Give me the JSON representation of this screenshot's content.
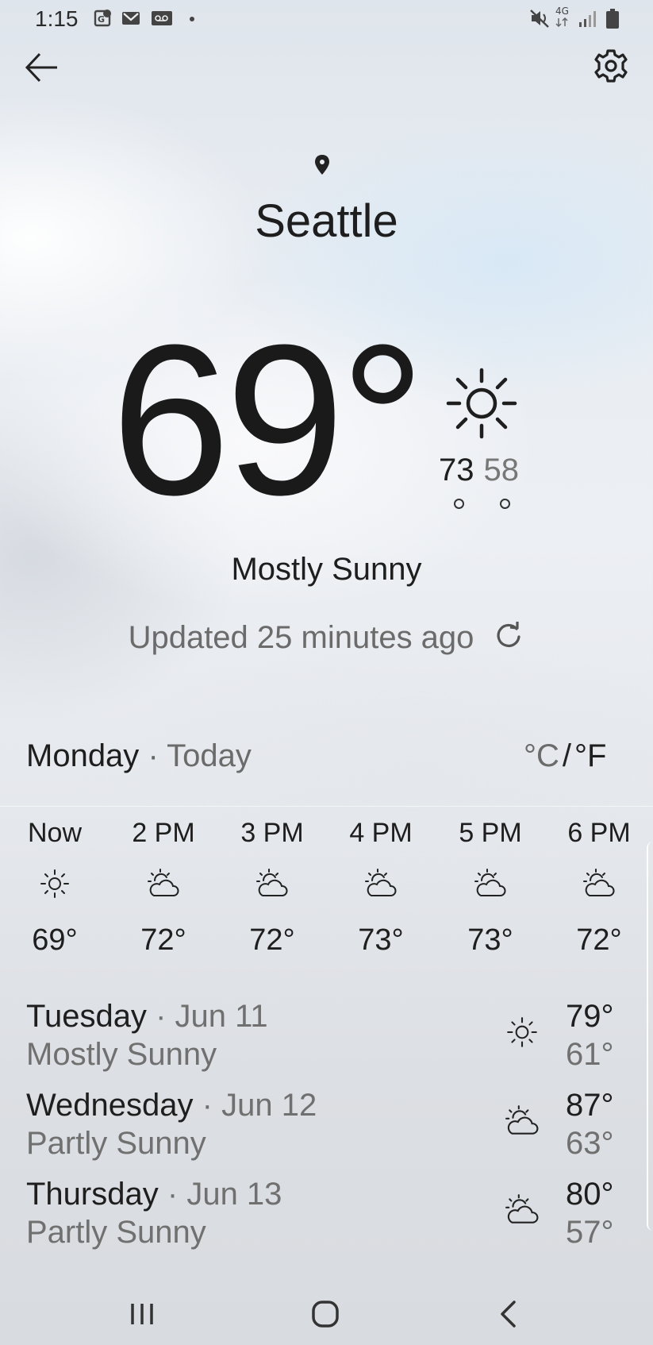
{
  "status_bar": {
    "time": "1:15",
    "network": "4G"
  },
  "header": {
    "back_icon": "arrow-left-icon",
    "settings_icon": "gear-icon"
  },
  "location": {
    "city": "Seattle"
  },
  "current": {
    "temperature": "69°",
    "high": "73",
    "low": "58",
    "condition": "Mostly Sunny",
    "condition_icon": "sun-icon",
    "updated": "Updated 25 minutes ago"
  },
  "today": {
    "day": "Monday",
    "separator": "·",
    "label": "Today",
    "unit_celsius": "°C",
    "unit_slash": "/",
    "unit_fahrenheit": "°F"
  },
  "hourly": [
    {
      "time": "Now",
      "icon": "sun-icon",
      "temp": "69°"
    },
    {
      "time": "2 PM",
      "icon": "partly-sunny-icon",
      "temp": "72°"
    },
    {
      "time": "3 PM",
      "icon": "partly-sunny-icon",
      "temp": "72°"
    },
    {
      "time": "4 PM",
      "icon": "partly-sunny-icon",
      "temp": "73°"
    },
    {
      "time": "5 PM",
      "icon": "partly-sunny-icon",
      "temp": "73°"
    },
    {
      "time": "6 PM",
      "icon": "partly-sunny-icon",
      "temp": "72°"
    }
  ],
  "daily": [
    {
      "day": "Tuesday",
      "date": "Jun 11",
      "condition": "Mostly Sunny",
      "icon": "sun-icon",
      "high": "79°",
      "low": "61°"
    },
    {
      "day": "Wednesday",
      "date": "Jun 12",
      "condition": "Partly Sunny",
      "icon": "partly-sunny-icon",
      "high": "87°",
      "low": "63°"
    },
    {
      "day": "Thursday",
      "date": "Jun 13",
      "condition": "Partly Sunny",
      "icon": "partly-sunny-icon",
      "high": "80°",
      "low": "57°"
    }
  ],
  "nav": {
    "recents_icon": "recents-icon",
    "home_icon": "home-icon",
    "back_icon": "back-chevron-icon"
  }
}
